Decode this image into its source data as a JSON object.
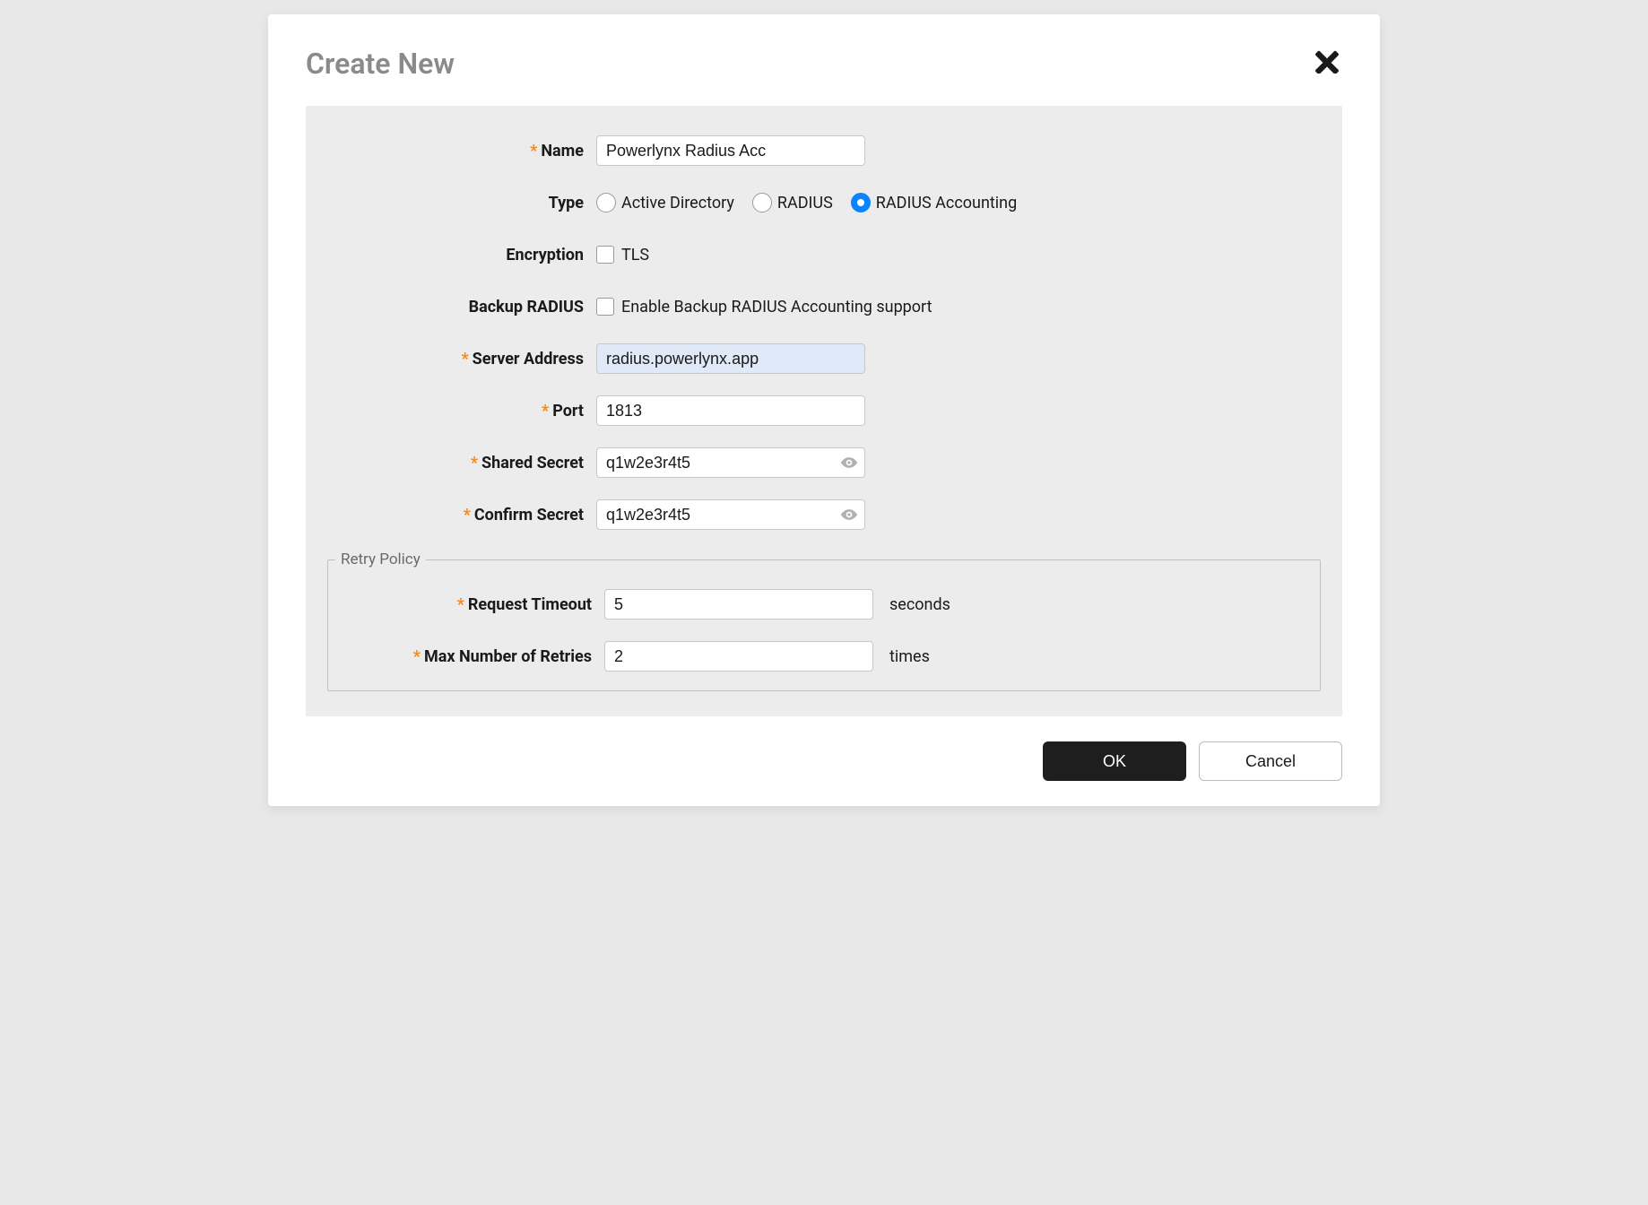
{
  "title": "Create New",
  "form": {
    "name": {
      "label": "Name",
      "value": "Powerlynx Radius Acc",
      "required": true
    },
    "type": {
      "label": "Type",
      "options": [
        {
          "label": "Active Directory",
          "selected": false
        },
        {
          "label": "RADIUS",
          "selected": false
        },
        {
          "label": "RADIUS Accounting",
          "selected": true
        }
      ]
    },
    "encryption": {
      "label": "Encryption",
      "option_label": "TLS",
      "checked": false
    },
    "backup_radius": {
      "label": "Backup RADIUS",
      "option_label": "Enable Backup RADIUS Accounting support",
      "checked": false
    },
    "server_address": {
      "label": "Server Address",
      "value": "radius.powerlynx.app",
      "required": true
    },
    "port": {
      "label": "Port",
      "value": "1813",
      "required": true
    },
    "shared_secret": {
      "label": "Shared Secret",
      "value": "q1w2e3r4t5",
      "required": true
    },
    "confirm_secret": {
      "label": "Confirm Secret",
      "value": "q1w2e3r4t5",
      "required": true
    },
    "retry": {
      "legend": "Retry Policy",
      "request_timeout": {
        "label": "Request Timeout",
        "value": "5",
        "suffix": "seconds",
        "required": true
      },
      "max_retries": {
        "label": "Max Number of Retries",
        "value": "2",
        "suffix": "times",
        "required": true
      }
    }
  },
  "footer": {
    "ok": "OK",
    "cancel": "Cancel"
  }
}
